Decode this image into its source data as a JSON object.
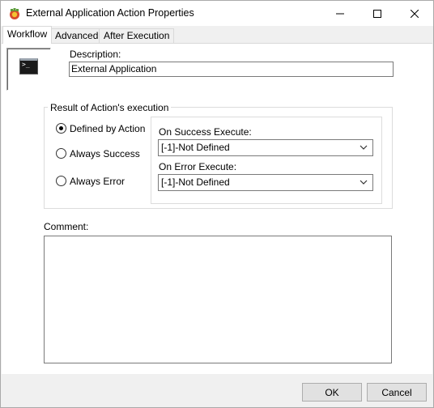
{
  "window": {
    "title": "External Application Action Properties",
    "controls": {
      "minimize": "minimize-icon",
      "maximize": "maximize-icon",
      "close": "close-icon"
    }
  },
  "tabs": [
    {
      "label": "Workflow",
      "active": true
    },
    {
      "label": "Advanced",
      "active": false
    },
    {
      "label": "After Execution",
      "active": false
    }
  ],
  "workflow": {
    "action_icon": "terminal-icon",
    "description_label": "Description:",
    "description_value": "External Application",
    "result_group": {
      "title": "Result of Action's execution",
      "options": [
        {
          "label": "Defined by  Action",
          "checked": true
        },
        {
          "label": "Always Success",
          "checked": false
        },
        {
          "label": "Always Error",
          "checked": false
        }
      ],
      "on_success_label": "On Success Execute:",
      "on_success_value": "[-1]-Not Defined",
      "on_error_label": "On Error Execute:",
      "on_error_value": "[-1]-Not Defined"
    },
    "comment_label": "Comment:",
    "comment_value": ""
  },
  "buttons": {
    "ok": "OK",
    "cancel": "Cancel"
  }
}
